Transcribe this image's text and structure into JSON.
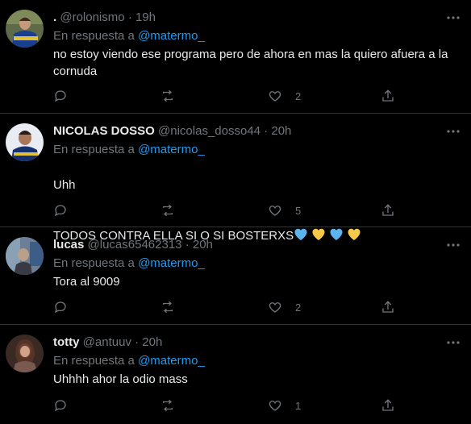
{
  "colors": {
    "background": "#000000",
    "text": "#e7e9ea",
    "muted": "#71767b",
    "link": "#1d9bf0",
    "divider": "#2f3336",
    "heart_blue": "#5bb4ee",
    "heart_yellow": "#f7c948"
  },
  "tweets": [
    {
      "display_name": ".",
      "handle": "@rolonismo",
      "separator": "·",
      "time": "19h",
      "reply_prefix": "En respuesta a",
      "reply_to": "@matermo_",
      "text": "no estoy viendo ese programa pero de ahora en mas la quiero afuera a la\ncornuda",
      "likes": "2",
      "avatar_icon": "soccer-player-avatar-icon"
    },
    {
      "display_name": "NICOLAS DOSSO",
      "handle": "@nicolas_dosso44",
      "separator": "·",
      "time": "20h",
      "reply_prefix": "En respuesta a",
      "reply_to": "@matermo_",
      "text_line1": "Uhh",
      "text_line2": "TODOS CONTRA ELLA SI O SI BOSTERXS",
      "likes": "5",
      "avatar_icon": "soccer-player-avatar-icon"
    },
    {
      "display_name": "lucas",
      "handle": "@lucas65462313",
      "separator": "·",
      "time": "20h",
      "reply_prefix": "En respuesta a",
      "reply_to": "@matermo_",
      "text": "Tora al 9009",
      "likes": "2",
      "avatar_icon": "photo-avatar-icon"
    },
    {
      "display_name": "totty",
      "handle": "@antuuv",
      "separator": "·",
      "time": "20h",
      "reply_prefix": "En respuesta a",
      "reply_to": "@matermo_",
      "text": "Uhhhh ahor la odio mass",
      "likes": "1",
      "avatar_icon": "photo-avatar-icon"
    }
  ]
}
